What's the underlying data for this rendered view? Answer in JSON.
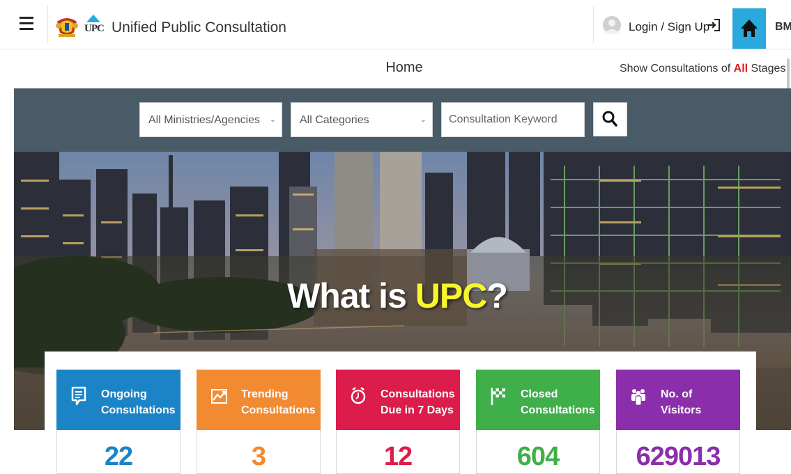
{
  "header": {
    "site_title": "Unified Public Consultation",
    "logo_text": "UPC",
    "login_label": "Login / Sign Up",
    "language": "BM",
    "icons": {
      "menu": "hamburger-icon",
      "avatar": "user-avatar-icon",
      "login": "sign-in-icon",
      "home": "home-icon"
    }
  },
  "subheader": {
    "page_title": "Home",
    "stage_filter": {
      "prefix": "Show Consultations of ",
      "highlight": "All",
      "suffix": " Stages",
      "caret": "▼"
    }
  },
  "search": {
    "ministry_select": "All Ministries/Agencies",
    "category_select": "All Categories",
    "keyword_placeholder": "Consultation Keyword",
    "keyword_value": "",
    "select_caret": "⌄",
    "search_icon": "search-icon"
  },
  "hero": {
    "heading_prefix": "What is ",
    "heading_accent": "UPC",
    "heading_suffix": "?"
  },
  "stats": [
    {
      "label": "Ongoing Consultations",
      "line1": "Ongoing",
      "line2": "Consultations",
      "value": "22",
      "color": "#1b84c7",
      "icon": "document-chat-icon"
    },
    {
      "label": "Trending Consultations",
      "line1": "Trending",
      "line2": "Consultations",
      "value": "3",
      "color": "#f28a31",
      "icon": "trending-chart-icon"
    },
    {
      "label": "Consultations Due in 7 Days",
      "line1": "Consultations",
      "line2": "Due in 7 Days",
      "value": "12",
      "color": "#dc1c4b",
      "icon": "alarm-clock-icon"
    },
    {
      "label": "Closed Consultations",
      "line1": "Closed",
      "line2": "Consultations",
      "value": "604",
      "color": "#3fb049",
      "icon": "checkered-flag-icon"
    },
    {
      "label": "No. of Visitors",
      "line1": "No. of",
      "line2": "Visitors",
      "value": "629013",
      "color": "#8b2eab",
      "icon": "visitors-group-icon"
    }
  ]
}
